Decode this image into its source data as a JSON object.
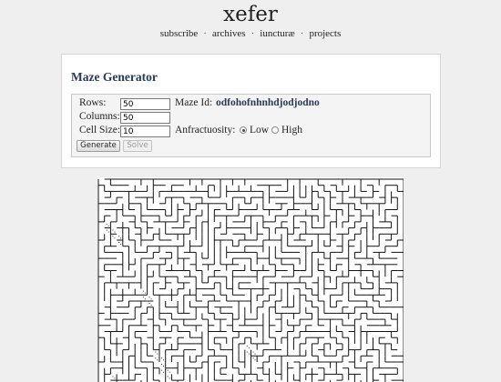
{
  "site": {
    "title": "xefer",
    "nav": [
      {
        "label": "subscribe"
      },
      {
        "label": "archives"
      },
      {
        "label": "iuncturæ"
      },
      {
        "label": "projects"
      }
    ],
    "separator": "·"
  },
  "panel": {
    "title": "Maze Generator",
    "form": {
      "rows_label": "Rows:",
      "rows_value": "50",
      "columns_label": "Columns:",
      "columns_value": "50",
      "cell_size_label": "Cell Size:",
      "cell_size_value": "10",
      "maze_id_label": "Maze Id:",
      "maze_id_value": "odfohofnhnhdjodjodno",
      "anfractuosity_label": "Anfractuosity:",
      "option_low": "Low",
      "option_high": "High",
      "selected": "Low",
      "generate_label": "Generate",
      "solve_label": "Solve"
    }
  },
  "maze": {
    "rows": 50,
    "columns": 50,
    "wall_color": "#111111",
    "background": "#ffffff",
    "dot_color": "#333333"
  }
}
